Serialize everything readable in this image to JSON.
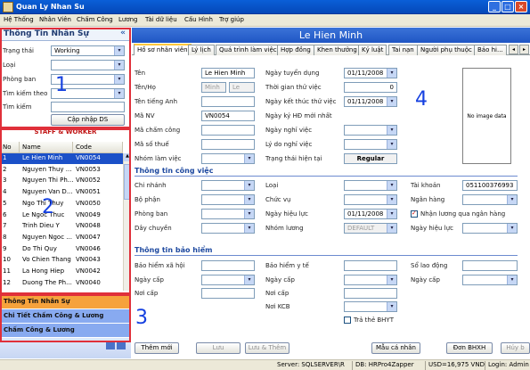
{
  "window": {
    "title": "Quan Ly Nhan Su"
  },
  "menu": [
    "Hệ Thống",
    "Nhân Viên",
    "Chấm Công",
    "Lương",
    "Tài dữ liệu",
    "Cấu Hình",
    "Trợ giúp"
  ],
  "left": {
    "title": "Thông Tin Nhân Sự",
    "collapse": "«",
    "filters": {
      "trang_thai_label": "Trạng thái",
      "trang_thai_value": "Working",
      "loai_label": "Loại",
      "phong_ban_label": "Phòng ban",
      "tim_kiem_theo_label": "Tìm kiếm theo",
      "tim_kiem_label": "Tìm kiếm",
      "update_button": "Cập nhập DS"
    },
    "staff_title": "STAFF & WORKER",
    "grid": {
      "headers": [
        "No",
        "Name",
        "Code"
      ],
      "rows": [
        [
          "1",
          "Le Hien Minh",
          "VN0054"
        ],
        [
          "2",
          "Nguyen Thuy ...",
          "VN0053"
        ],
        [
          "3",
          "Nguyen Thi Ph...",
          "VN0052"
        ],
        [
          "4",
          "Nguyen Van D...",
          "VN0051"
        ],
        [
          "5",
          "Ngo Thi Thuy",
          "VN0050"
        ],
        [
          "6",
          "Le Ngoc Thuc",
          "VN0049"
        ],
        [
          "7",
          "Trinh Dieu Y",
          "VN0048"
        ],
        [
          "8",
          "Nguyen Ngoc ...",
          "VN0047"
        ],
        [
          "9",
          "Do Thi Quy",
          "VN0046"
        ],
        [
          "10",
          "Vo Chien Thang",
          "VN0043"
        ],
        [
          "11",
          "La Hong Hiep",
          "VN0042"
        ],
        [
          "12",
          "Duong The Ph...",
          "VN0040"
        ]
      ]
    },
    "nav": [
      "Thông Tin Nhân Sự",
      "Chi Tiết Chấm Công & Lương",
      "Chấm Công & Lương"
    ],
    "nav_colors": [
      "#f6a23c",
      "#88aaf0",
      "#88aaf0"
    ]
  },
  "employee": {
    "name": "Le Hien Minh"
  },
  "tabs": [
    "Hồ sơ nhân viên",
    "Lý lịch",
    "Quá trình làm việc",
    "Hợp đồng",
    "Khen thưởng",
    "Kỷ luật",
    "Tai nạn",
    "Người phụ thuộc",
    "Bảo hi..."
  ],
  "profile": {
    "ten_label": "Tên",
    "ten_value": "Le Hien Minh",
    "tenho_label": "Tên/Họ",
    "tenho_ph1": "Minh",
    "tenho_ph2": "Le",
    "tentienganh_label": "Tên tiếng Anh",
    "manv_label": "Mã NV",
    "manv_value": "VN0054",
    "machamcong_label": "Mã chấm công",
    "masothue_label": "Mã số thuế",
    "nhomlamviec_label": "Nhóm làm việc",
    "ngaytuyendung_label": "Ngày tuyển dụng",
    "ngaytuyendung_value": "01/11/2008",
    "thoigianthuviec_label": "Thời gian thử việc",
    "thoigianthuviec_value": "0",
    "ngayketthuc_label": "Ngày kết thúc thử việc",
    "ngayketthuc_value": "01/11/2008",
    "ngaykyhd_label": "Ngày ký HĐ mới nhất",
    "ngaynghiviec_label": "Ngày nghỉ việc",
    "lydonghiviec_label": "Lý do nghỉ việc",
    "trangthaihientai_label": "Trạng thái hiện tại",
    "trangthaihientai_value": "Regular",
    "photo_text": "No image data"
  },
  "work": {
    "title": "Thông tin công việc",
    "chinhanh_label": "Chi nhánh",
    "bophan_label": "Bộ phận",
    "phongban_label": "Phòng ban",
    "daychuyen_label": "Dây chuyền",
    "loai_label": "Loại",
    "chucvu_label": "Chức vụ",
    "ngayhieuluc_label": "Ngày hiệu lực",
    "ngayhieuluc_value": "01/11/2008",
    "nhomluong_label": "Nhóm lương",
    "nhomluong_value": "DEFAULT",
    "taikhoan_label": "Tài khoản",
    "taikhoan_value": "051100376993",
    "nganhang_label": "Ngân hàng",
    "nhanluong_label": "Nhận lương qua ngân hàng",
    "ngayhieuluc2_label": "Ngày hiệu lực"
  },
  "insurance": {
    "title": "Thông tin bảo hiểm",
    "bhxh_label": "Bảo hiểm xã hội",
    "ngaycap1_label": "Ngày cấp",
    "noicap1_label": "Nơi cấp",
    "bhyt_label": "Bảo hiểm y tế",
    "ngaycap2_label": "Ngày cấp",
    "noicap2_label": "Nơi cấp",
    "noikcb_label": "Nơi KCB",
    "trathe_label": "Trả thẻ BHYT",
    "solaodong_label": "Sổ lao động",
    "ngaycap3_label": "Ngày cấp"
  },
  "buttons": {
    "them_moi": "Thêm mới",
    "luu": "Lưu",
    "luu_them": "Lưu & Thêm",
    "mau_ca_nhan": "Mẫu cá nhân",
    "don_bhxh": "Đơn BHXH",
    "huy": "Hủy b"
  },
  "status": {
    "server": "Server: SQLSERVER\\R",
    "db": "DB: HRPro4Zapper",
    "usd": "USD=16,975 VND",
    "login": "Login: Admin - admin"
  },
  "annotations": [
    "1",
    "2",
    "3",
    "4"
  ]
}
